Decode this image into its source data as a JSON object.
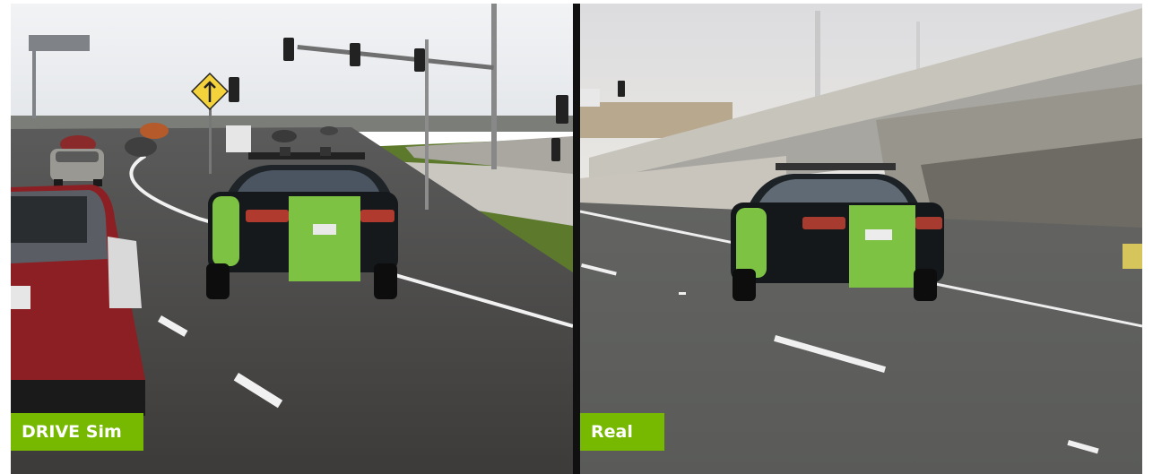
{
  "panels": {
    "sim": {
      "label": "DRIVE Sim"
    },
    "real": {
      "label": "Real"
    }
  },
  "colors": {
    "label_bg": "#76b900",
    "divider": "#101010",
    "car_green": "#7dc242"
  },
  "icons": {
    "road_sign": "merge-arrow-sign-icon",
    "traffic_light": "traffic-light-icon"
  }
}
